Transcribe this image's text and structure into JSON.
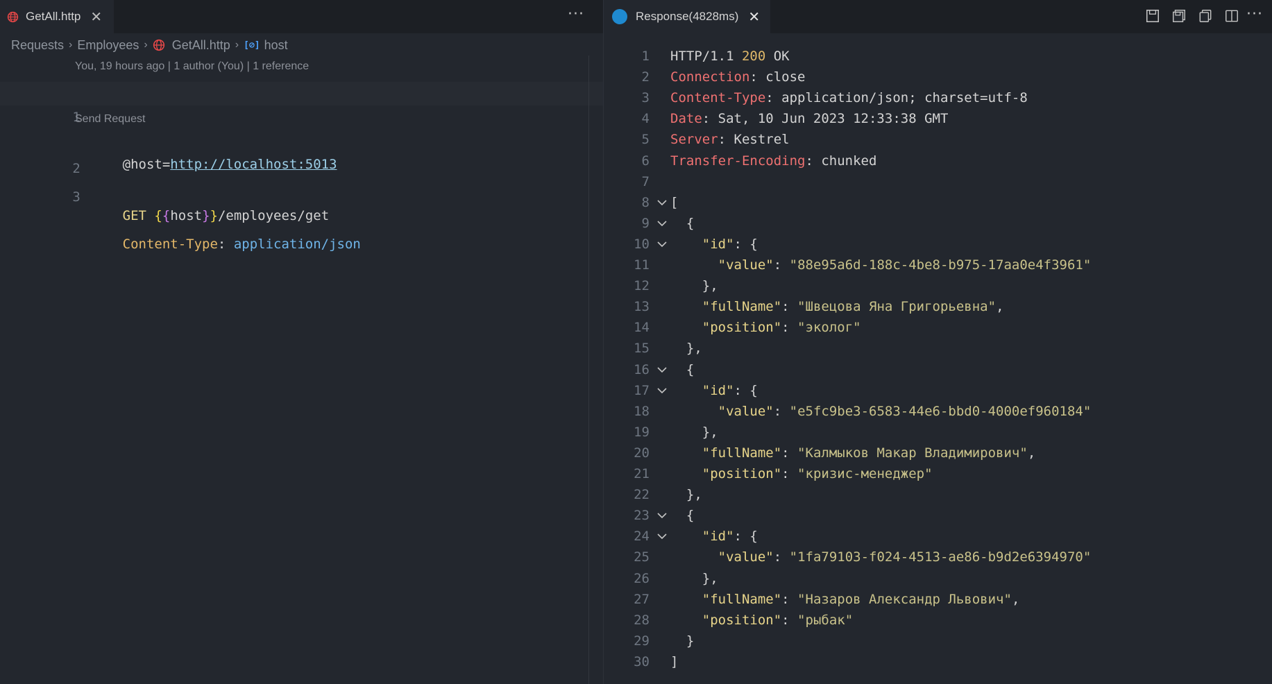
{
  "left": {
    "tab": {
      "label": "GetAll.http",
      "close": "✕"
    },
    "more": "···",
    "breadcrumb": [
      "Requests",
      "Employees",
      "GetAll.http",
      "host"
    ],
    "blame": "You, 19 hours ago | 1 author (You) | 1 reference",
    "send_request": "Send Request",
    "line_numbers": [
      "1",
      "2",
      "3"
    ],
    "line1": {
      "at": "@host",
      "eq": "=",
      "url": "http://localhost:5013"
    },
    "line2": {
      "method": "GET ",
      "open1": "{",
      "open2": "{",
      "var": "host",
      "close2": "}",
      "close1": "}",
      "path": "/employees/get"
    },
    "line3": {
      "key": "Content-Type",
      "colon": ": ",
      "value": "application/json"
    }
  },
  "right": {
    "tab": {
      "label": "Response(4828ms)",
      "close": "✕"
    },
    "more": "···",
    "toolbar_icons": [
      "save-icon",
      "save-body-icon",
      "copy-icon",
      "split-editor-icon"
    ],
    "status_line": {
      "proto": "HTTP/1.1 ",
      "code": "200",
      "text": " OK"
    },
    "headers": [
      {
        "key": "Connection",
        "value": "close"
      },
      {
        "key": "Content-Type",
        "value": "application/json; charset=utf-8"
      },
      {
        "key": "Date",
        "value": "Sat, 10 Jun 2023 12:33:38 GMT"
      },
      {
        "key": "Server",
        "value": "Kestrel"
      },
      {
        "key": "Transfer-Encoding",
        "value": "chunked"
      }
    ],
    "employees": [
      {
        "id_value": "88e95a6d-188c-4be8-b975-17aa0e4f3961",
        "fullName": "Швецова Яна Григорьевна",
        "position": "эколог"
      },
      {
        "id_value": "e5fc9be3-6583-44e6-bbd0-4000ef960184",
        "fullName": "Калмыков Макар Владимирович",
        "position": "кризис-менеджер"
      },
      {
        "id_value": "1fa79103-f024-4513-ae86-b9d2e6394970",
        "fullName": "Назаров Александр Львович",
        "position": "рыбак"
      }
    ]
  },
  "colors": {
    "editor_bg": "#23272e",
    "http_globe": "#e84848",
    "response_badge": "#1f8ad0",
    "accent_link": "#4ea3ff"
  }
}
